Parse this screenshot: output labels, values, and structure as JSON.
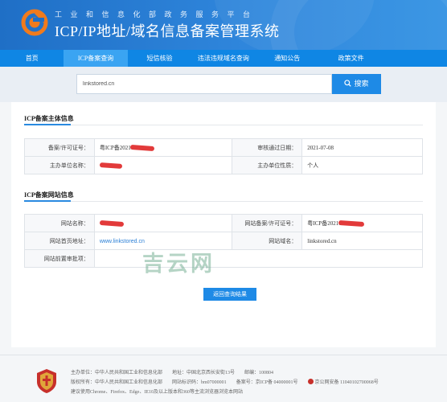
{
  "header": {
    "department": "工业和信息化部政务服务平台",
    "system_name": "ICP/IP地址/域名信息备案管理系统"
  },
  "nav": {
    "items": [
      "首页",
      "ICP备案查询",
      "短信核验",
      "违法违规域名查询",
      "通知公告",
      "政策文件"
    ]
  },
  "search": {
    "value": "linkstored.cn",
    "button_label": "搜索"
  },
  "subject_section": {
    "title": "ICP备案主体信息",
    "rows": [
      {
        "label1": "备案/许可证号：",
        "value1": "粤ICP备20210",
        "label2": "审核通过日期：",
        "value2": "2021-07-08"
      },
      {
        "label1": "主办单位名称：",
        "value1": "",
        "label2": "主办单位性质：",
        "value2": "个人"
      }
    ]
  },
  "site_section": {
    "title": "ICP备案网站信息",
    "rows": [
      {
        "label1": "网站名称：",
        "value1": "",
        "label2": "网站备案/许可证号：",
        "value2": "粤ICP备20210"
      },
      {
        "label1": "网站首页地址：",
        "value1": "www.linkstored.cn",
        "label2": "网站域名：",
        "value2": "linkstored.cn"
      },
      {
        "label1": "网站前置审批项：",
        "value1": "",
        "label2": "",
        "value2": ""
      }
    ]
  },
  "watermark": "吉云网",
  "back_button": "返回查询结果",
  "footer": {
    "line1": [
      "主办单位：中华人民共和国工业和信息化部",
      "地址：中国北京西长安街13号",
      "邮编：100804"
    ],
    "line2": [
      "版权所有：中华人民共和国工业和信息化部",
      "网站标识码：bm07000001",
      "备案号：京ICP备 04000001号",
      "京公网安备 11040102700068号"
    ],
    "line3": "建议使用Chrome、Firefox、Edge、IE10及以上版本和360等主流浏览器浏览本网站"
  },
  "colors": {
    "header_blue": "#1f6fc6",
    "nav_blue": "#0f86e4",
    "accent_blue": "#1e8ae6",
    "redaction_red": "#e23a3a"
  },
  "icons": [
    "logo-icon",
    "search-icon",
    "emblem-icon",
    "police-badge-icon"
  ]
}
